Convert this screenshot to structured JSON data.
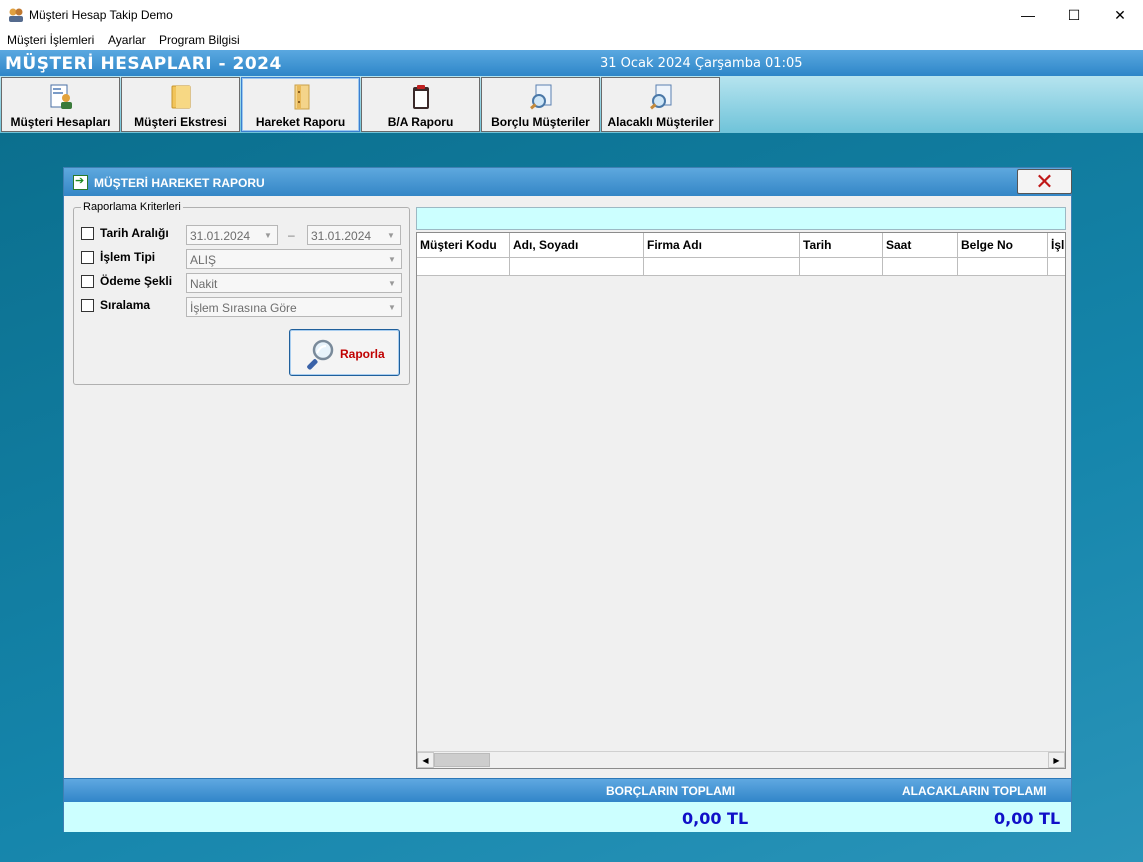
{
  "window": {
    "title": "Müşteri Hesap Takip Demo",
    "minimize_glyph": "—",
    "maximize_glyph": "☐",
    "close_glyph": "✕"
  },
  "menu": [
    "Müşteri İşlemleri",
    "Ayarlar",
    "Program Bilgisi"
  ],
  "header": {
    "title": "MÜŞTERİ HESAPLARI - 2024",
    "datetime": "31 Ocak 2024 Çarşamba 01:05"
  },
  "toolbar": {
    "buttons": [
      {
        "label": "Müşteri Hesapları",
        "icon": "customer-card-icon"
      },
      {
        "label": "Müşteri Ekstresi",
        "icon": "folder-icon"
      },
      {
        "label": "Hareket Raporu",
        "icon": "binder-icon",
        "active": true
      },
      {
        "label": "B/A Raporu",
        "icon": "clipboard-icon"
      },
      {
        "label": "Borçlu Müşteriler",
        "icon": "document-search-icon"
      },
      {
        "label": "Alacaklı Müşteriler",
        "icon": "document-search-icon"
      }
    ]
  },
  "dialog": {
    "title": "MÜŞTERİ HAREKET RAPORU",
    "close_glyph": "✕",
    "criteria": {
      "legend": "Raporlama Kriterleri",
      "date_range": {
        "label": "Tarih Aralığı",
        "from": "31.01.2024",
        "separator": "–",
        "to": "31.01.2024"
      },
      "transaction_type": {
        "label": "İşlem Tipi",
        "value": "ALIŞ"
      },
      "payment_method": {
        "label": "Ödeme Şekli",
        "value": "Nakit"
      },
      "sorting": {
        "label": "Sıralama",
        "value": "İşlem Sırasına Göre"
      },
      "report_button": "Raporla"
    },
    "grid": {
      "columns": [
        "Müşteri Kodu",
        "Adı, Soyadı",
        "Firma Adı",
        "Tarih",
        "Saat",
        "Belge No",
        "İşl"
      ]
    },
    "footer": {
      "debt_total_label": "BORÇLARIN TOPLAMI",
      "debt_total_value": "0,00 TL",
      "credit_total_label": "ALACAKLARIN TOPLAMI",
      "credit_total_value": "0,00 TL"
    }
  },
  "colors": {
    "header_blue": "#3486c6",
    "toolbar_cyan": "#8fd3e5",
    "background_teal": "#1585ab",
    "total_value_blue": "#1010c8",
    "report_button_text": "#c00000"
  }
}
